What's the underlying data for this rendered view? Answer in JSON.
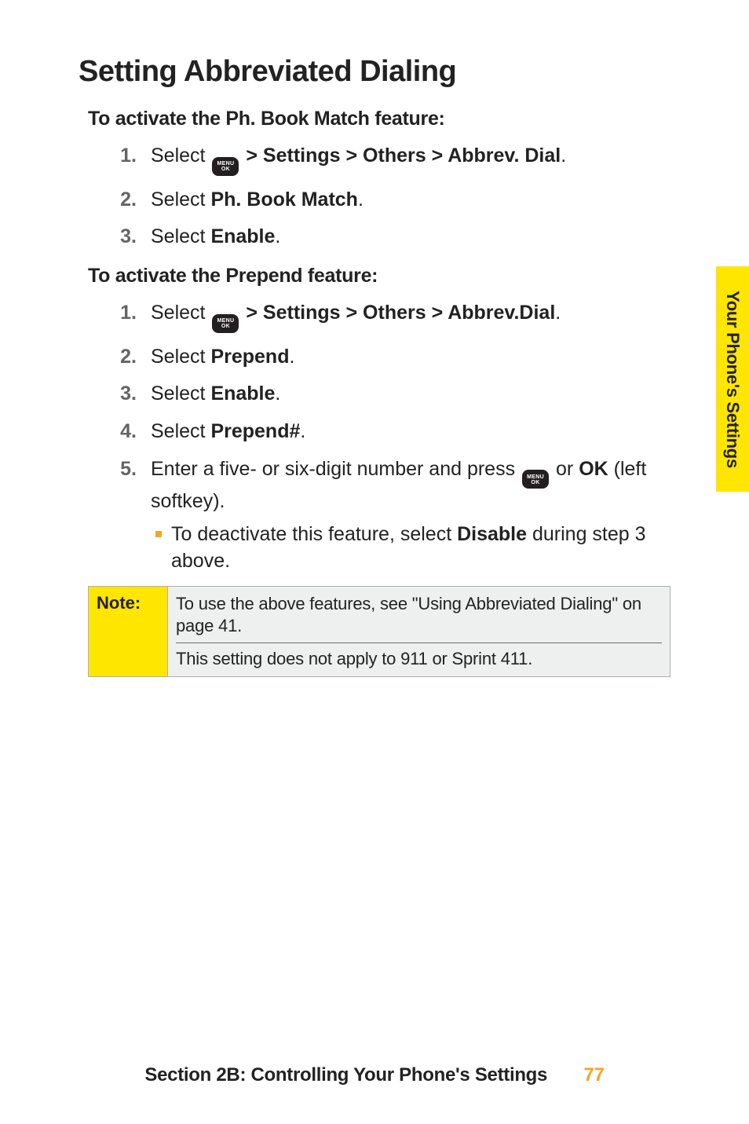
{
  "heading": "Setting Abbreviated Dialing",
  "sub1": "To activate the Ph. Book Match feature:",
  "sub2": "To activate the Prepend feature:",
  "menu_icon": {
    "line1": "MENU",
    "line2": "OK"
  },
  "proc1": {
    "s1_pre": "Select ",
    "s1_path": " > Settings > Others > Abbrev. Dial",
    "s1_post": ".",
    "s2_pre": "Select ",
    "s2_bold": "Ph. Book Match",
    "s2_post": ".",
    "s3_pre": "Select ",
    "s3_bold": "Enable",
    "s3_post": "."
  },
  "proc2": {
    "s1_pre": "Select ",
    "s1_path": " > Settings > Others > Abbrev.Dial",
    "s1_post": ".",
    "s2_pre": "Select ",
    "s2_bold": "Prepend",
    "s2_post": ".",
    "s3_pre": "Select ",
    "s3_bold": "Enable",
    "s3_post": ".",
    "s4_pre": "Select ",
    "s4_bold": "Prepend#",
    "s4_post": ".",
    "s5_pre": "Enter a five- or six-digit number and press ",
    "s5_mid": " or ",
    "s5_bold": "OK",
    "s5_post": " (left softkey).",
    "bullet_pre": "To deactivate this feature, select ",
    "bullet_bold": "Disable",
    "bullet_post": " during step 3 above."
  },
  "note_label": "Note:",
  "note_line1": "To use the above features, see \"Using Abbreviated Dialing\" on page 41.",
  "note_line2": "This setting does not apply to 911 or Sprint 411.",
  "side_tab": "Your Phone's Settings",
  "footer_text": "Section 2B: Controlling Your Phone's Settings",
  "page_number": "77"
}
